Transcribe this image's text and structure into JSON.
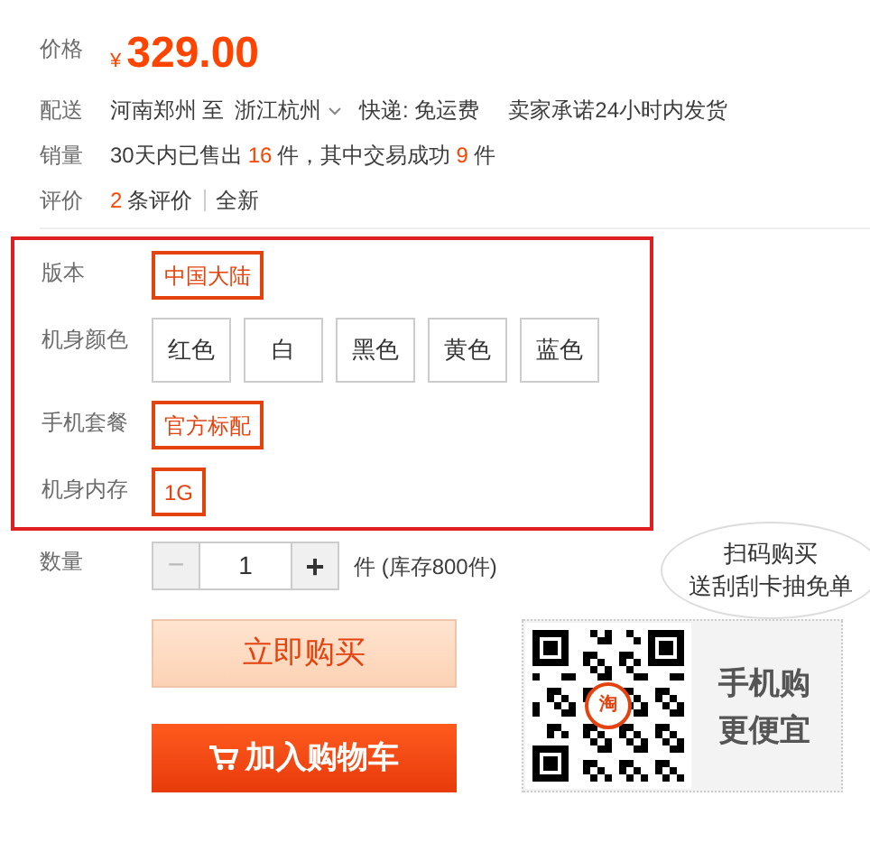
{
  "price": {
    "label": "价格",
    "currency": "¥",
    "amount": "329.00"
  },
  "delivery": {
    "label": "配送",
    "from": "河南郑州",
    "to_word": "至",
    "to": "浙江杭州",
    "shipping": "快递: 免运费",
    "promise": "卖家承诺24小时内发货"
  },
  "sales": {
    "label": "销量",
    "parts": [
      "30天内已售出",
      "16",
      "件，其中交易成功",
      "9",
      "件"
    ]
  },
  "reviews": {
    "label": "评价",
    "count": "2",
    "count_text": "条评价",
    "condition": "全新"
  },
  "options": [
    {
      "label": "版本",
      "values": [
        {
          "text": "中国大陆",
          "selected": true
        }
      ]
    },
    {
      "label": "机身颜色",
      "values": [
        {
          "text": "红色",
          "selected": false
        },
        {
          "text": "白",
          "selected": false
        },
        {
          "text": "黑色",
          "selected": false
        },
        {
          "text": "黄色",
          "selected": false
        },
        {
          "text": "蓝色",
          "selected": false
        }
      ]
    },
    {
      "label": "手机套餐",
      "values": [
        {
          "text": "官方标配",
          "selected": true
        }
      ]
    },
    {
      "label": "机身内存",
      "values": [
        {
          "text": "1G",
          "selected": true
        }
      ]
    }
  ],
  "quantity": {
    "label": "数量",
    "minus": "−",
    "value": "1",
    "plus": "+",
    "stock": "件 (库存800件)"
  },
  "buttons": {
    "buy_now": "立即购买",
    "add_to_cart": "加入购物车"
  },
  "mobile": {
    "bubble": [
      "扫码购买",
      "送刮刮卡抽免单"
    ],
    "badge": "淘",
    "title": "手机购",
    "subtitle": "更便宜"
  }
}
